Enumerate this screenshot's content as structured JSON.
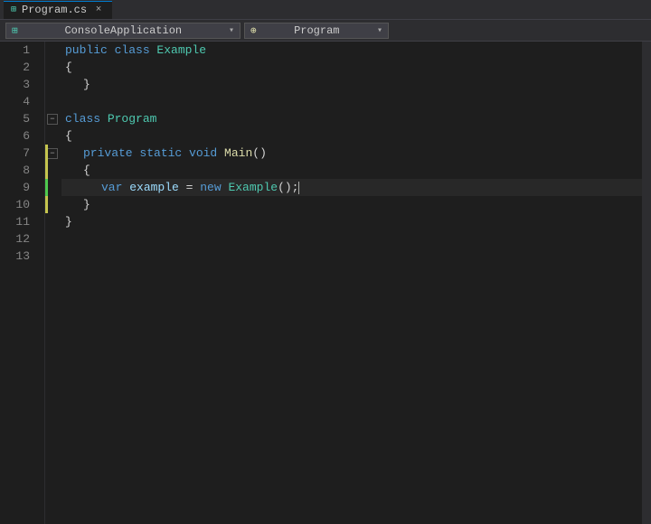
{
  "titlebar": {
    "tab_name": "Program.cs",
    "tab_icon": "CS",
    "close_label": "×"
  },
  "navbar": {
    "left_dropdown_icon": "app",
    "left_dropdown_text": "ConsoleApplication",
    "right_dropdown_icon": "method",
    "right_dropdown_text": "Program"
  },
  "editor": {
    "lines": [
      {
        "num": 1,
        "indent": 0,
        "has_collapse": false,
        "collapse_type": "",
        "content": [
          {
            "type": "kw",
            "text": "public "
          },
          {
            "type": "kw",
            "text": "class "
          },
          {
            "type": "type",
            "text": "Example"
          }
        ],
        "scope_indicator": false
      },
      {
        "num": 2,
        "indent": 0,
        "has_collapse": false,
        "collapse_type": "",
        "content": [
          {
            "type": "punc",
            "text": "{"
          }
        ],
        "scope_indicator": false
      },
      {
        "num": 3,
        "indent": 1,
        "has_collapse": false,
        "collapse_type": "",
        "content": [
          {
            "type": "punc",
            "text": "}"
          }
        ],
        "scope_indicator": false
      },
      {
        "num": 4,
        "indent": 0,
        "has_collapse": false,
        "collapse_type": "",
        "content": [],
        "scope_indicator": false
      },
      {
        "num": 5,
        "indent": 0,
        "has_collapse": true,
        "collapse_type": "minus",
        "content": [
          {
            "type": "kw",
            "text": "class "
          },
          {
            "type": "type",
            "text": "Program"
          }
        ],
        "scope_indicator": false
      },
      {
        "num": 6,
        "indent": 0,
        "has_collapse": false,
        "collapse_type": "",
        "content": [
          {
            "type": "punc",
            "text": "{"
          }
        ],
        "scope_indicator": false
      },
      {
        "num": 7,
        "indent": 1,
        "has_collapse": true,
        "collapse_type": "minus",
        "content": [
          {
            "type": "kw",
            "text": "private "
          },
          {
            "type": "kw",
            "text": "static "
          },
          {
            "type": "kw",
            "text": "void "
          },
          {
            "type": "method",
            "text": "Main"
          },
          {
            "type": "punc",
            "text": "()"
          }
        ],
        "scope_indicator": true,
        "scope_color": "yellow"
      },
      {
        "num": 8,
        "indent": 1,
        "has_collapse": false,
        "collapse_type": "",
        "content": [
          {
            "type": "punc",
            "text": "{"
          }
        ],
        "scope_indicator": true,
        "scope_color": "yellow"
      },
      {
        "num": 9,
        "indent": 2,
        "has_collapse": false,
        "collapse_type": "",
        "content": [
          {
            "type": "kw",
            "text": "var "
          },
          {
            "type": "identifier",
            "text": "example"
          },
          {
            "type": "op",
            "text": " = "
          },
          {
            "type": "kw",
            "text": "new "
          },
          {
            "type": "type",
            "text": "Example"
          },
          {
            "type": "punc",
            "text": "();"
          },
          {
            "type": "cursor",
            "text": ""
          }
        ],
        "scope_indicator": true,
        "scope_color": "green",
        "highlight": true
      },
      {
        "num": 10,
        "indent": 1,
        "has_collapse": false,
        "collapse_type": "",
        "content": [
          {
            "type": "punc",
            "text": "}"
          }
        ],
        "scope_indicator": true,
        "scope_color": "yellow"
      },
      {
        "num": 11,
        "indent": 0,
        "has_collapse": false,
        "collapse_type": "",
        "content": [
          {
            "type": "punc",
            "text": "}"
          }
        ],
        "scope_indicator": false
      },
      {
        "num": 12,
        "indent": 0,
        "has_collapse": false,
        "collapse_type": "",
        "content": [],
        "scope_indicator": false
      },
      {
        "num": 13,
        "indent": 0,
        "has_collapse": false,
        "collapse_type": "",
        "content": [],
        "scope_indicator": false
      }
    ]
  }
}
